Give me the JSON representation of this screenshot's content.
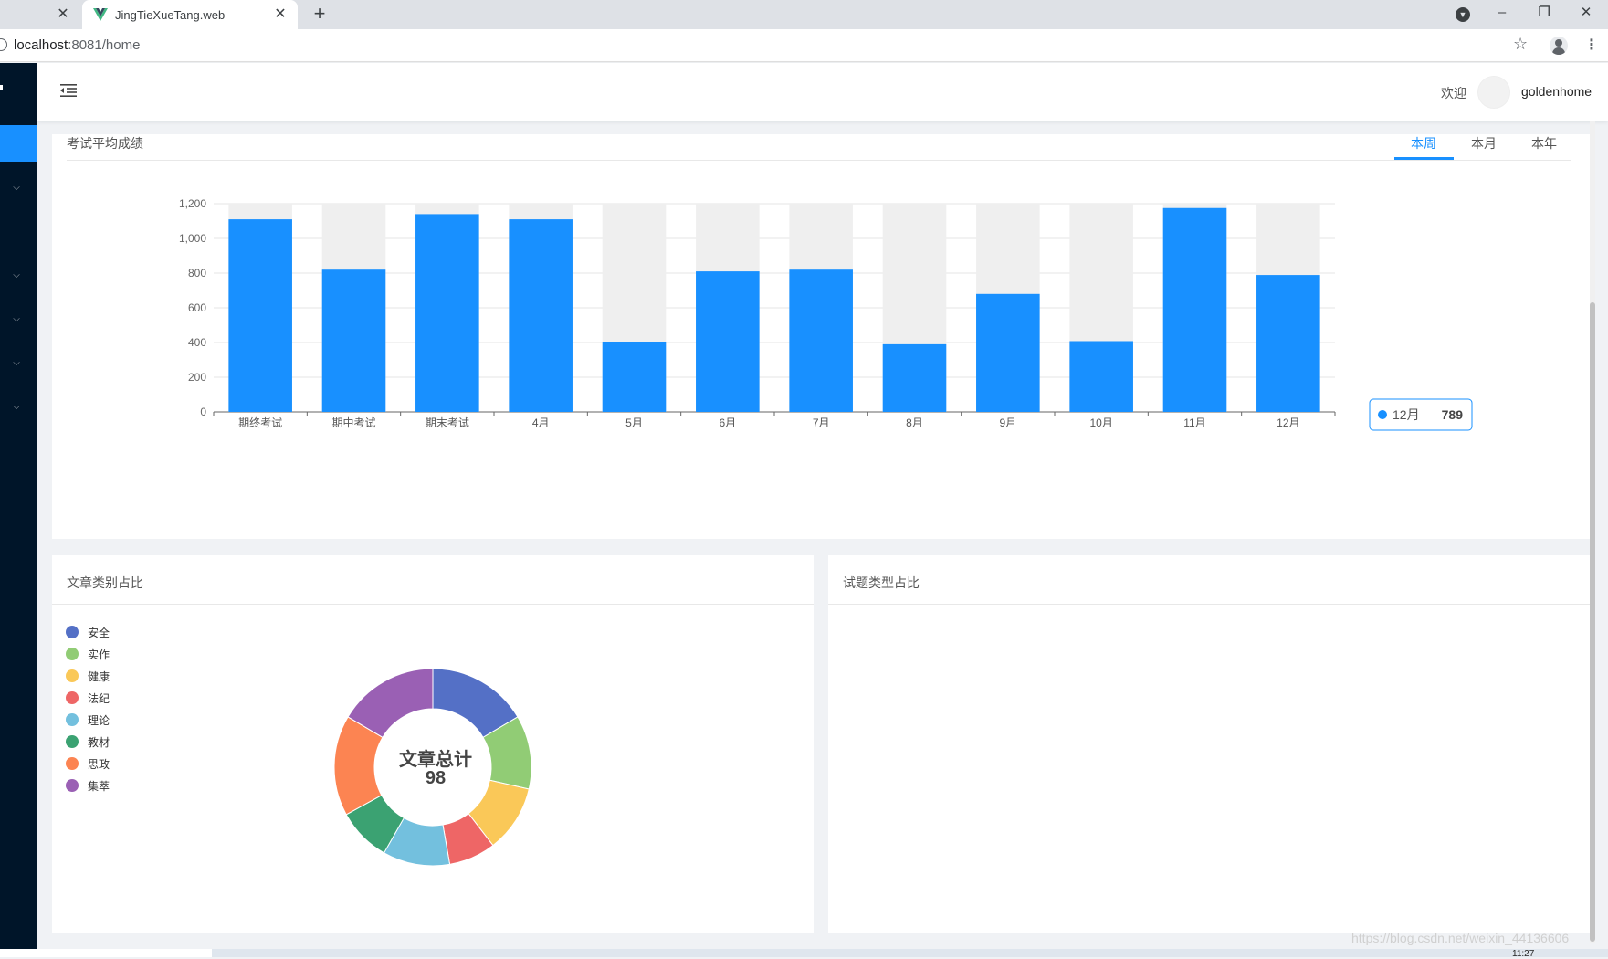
{
  "browser": {
    "tabs": [
      {
        "title": ""
      },
      {
        "title": "JingTieXueTang.web"
      }
    ],
    "url_host": "localhost",
    "url_path": ":8081/home"
  },
  "header": {
    "welcome": "欢迎",
    "username": "goldenhome"
  },
  "main_card": {
    "title": "考试平均成绩",
    "tabs": [
      "本周",
      "本月",
      "本年"
    ],
    "active_tab": "本周",
    "tooltip": {
      "label": "12月",
      "value": "789"
    }
  },
  "article_card": {
    "title": "文章类别占比",
    "center_label": "文章总计",
    "center_value": "98",
    "legend": [
      {
        "name": "安全",
        "color": "#5470c6"
      },
      {
        "name": "实作",
        "color": "#91cc75"
      },
      {
        "name": "健康",
        "color": "#fac858"
      },
      {
        "name": "法纪",
        "color": "#ee6666"
      },
      {
        "name": "理论",
        "color": "#73c0de"
      },
      {
        "name": "教材",
        "color": "#3ba272"
      },
      {
        "name": "思政",
        "color": "#fc8452"
      },
      {
        "name": "集萃",
        "color": "#9a60b4"
      }
    ]
  },
  "question_card": {
    "title": "试题类型占比"
  },
  "footer": {
    "watermark": "https://blog.csdn.net/weixin_44136606",
    "clock": "11:27"
  },
  "chart_data": [
    {
      "type": "bar",
      "title": "考试平均成绩",
      "categories": [
        "期终考试",
        "期中考试",
        "期末考试",
        "4月",
        "5月",
        "6月",
        "7月",
        "8月",
        "9月",
        "10月",
        "11月",
        "12月"
      ],
      "values": [
        1110,
        820,
        1140,
        1110,
        405,
        810,
        820,
        390,
        680,
        408,
        1175,
        789
      ],
      "background_max": 1200,
      "ylim": [
        0,
        1200
      ],
      "yticks": [
        0,
        200,
        400,
        600,
        800,
        1000,
        1200
      ],
      "ytick_labels": [
        "0",
        "200",
        "400",
        "600",
        "800",
        "1,000",
        "1,200"
      ],
      "grid": true,
      "bar_color": "#1890ff",
      "background_color": "#efefef"
    },
    {
      "type": "pie",
      "title": "文章类别占比",
      "donut": true,
      "categories": [
        "安全",
        "实作",
        "健康",
        "法纪",
        "理论",
        "教材",
        "思政",
        "集萃"
      ],
      "values": [
        15,
        11,
        10,
        7,
        10,
        8,
        15,
        15
      ],
      "colors": [
        "#5470c6",
        "#91cc75",
        "#fac858",
        "#ee6666",
        "#73c0de",
        "#3ba272",
        "#fc8452",
        "#9a60b4"
      ],
      "total": 98
    }
  ]
}
